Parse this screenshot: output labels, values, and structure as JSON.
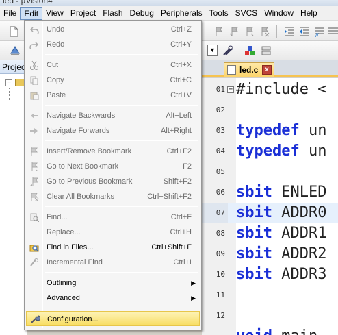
{
  "window": {
    "title": "led - µVision4"
  },
  "menubar": {
    "items": [
      {
        "name": "menu-file",
        "label": "File",
        "active": false
      },
      {
        "name": "menu-edit",
        "label": "Edit",
        "active": true
      },
      {
        "name": "menu-view",
        "label": "View",
        "active": false
      },
      {
        "name": "menu-project",
        "label": "Project",
        "active": false
      },
      {
        "name": "menu-flash",
        "label": "Flash",
        "active": false
      },
      {
        "name": "menu-debug",
        "label": "Debug",
        "active": false
      },
      {
        "name": "menu-peripherals",
        "label": "Peripherals",
        "active": false
      },
      {
        "name": "menu-tools",
        "label": "Tools",
        "active": false
      },
      {
        "name": "menu-svcs",
        "label": "SVCS",
        "active": false
      },
      {
        "name": "menu-window",
        "label": "Window",
        "active": false
      },
      {
        "name": "menu-help",
        "label": "Help",
        "active": false
      }
    ]
  },
  "project_panel": {
    "title": "Project"
  },
  "editor": {
    "tab_label": "led.c",
    "tab_close": "x",
    "lines": [
      {
        "num": "01",
        "code": "#include <",
        "fold": "−",
        "keyword": false
      },
      {
        "num": "02",
        "code": "",
        "keyword": false
      },
      {
        "num": "03",
        "code": "typedef un",
        "keyword": true,
        "kw": "typedef",
        "rest": " un"
      },
      {
        "num": "04",
        "code": "typedef un",
        "keyword": true,
        "kw": "typedef",
        "rest": " un"
      },
      {
        "num": "05",
        "code": "",
        "keyword": false
      },
      {
        "num": "06",
        "code": "sbit ENLED",
        "keyword": true,
        "kw": "sbit",
        "rest": " ENLED"
      },
      {
        "num": "07",
        "code": "sbit ADDR0",
        "keyword": true,
        "kw": "sbit",
        "rest": " ADDR0",
        "highlight": true
      },
      {
        "num": "08",
        "code": "sbit ADDR1",
        "keyword": true,
        "kw": "sbit",
        "rest": " ADDR1"
      },
      {
        "num": "09",
        "code": "sbit ADDR2",
        "keyword": true,
        "kw": "sbit",
        "rest": " ADDR2"
      },
      {
        "num": "10",
        "code": "sbit ADDR3",
        "keyword": true,
        "kw": "sbit",
        "rest": " ADDR3"
      },
      {
        "num": "11",
        "code": "",
        "keyword": false
      },
      {
        "num": "12",
        "code": "",
        "keyword": false
      },
      {
        "num": "",
        "code": "void main",
        "keyword": true,
        "kw": "void",
        "rest": " main"
      }
    ]
  },
  "edit_menu": {
    "items": [
      {
        "type": "item",
        "name": "menu-undo",
        "label": "Undo",
        "shortcut": "Ctrl+Z",
        "enabled": false,
        "icon": "undo-icon"
      },
      {
        "type": "item",
        "name": "menu-redo",
        "label": "Redo",
        "shortcut": "Ctrl+Y",
        "enabled": false,
        "icon": "redo-icon"
      },
      {
        "type": "sep"
      },
      {
        "type": "item",
        "name": "menu-cut",
        "label": "Cut",
        "shortcut": "Ctrl+X",
        "enabled": false,
        "icon": "scissors-icon"
      },
      {
        "type": "item",
        "name": "menu-copy",
        "label": "Copy",
        "shortcut": "Ctrl+C",
        "enabled": false,
        "icon": "copy-icon"
      },
      {
        "type": "item",
        "name": "menu-paste",
        "label": "Paste",
        "shortcut": "Ctrl+V",
        "enabled": false,
        "icon": "paste-icon"
      },
      {
        "type": "sep"
      },
      {
        "type": "item",
        "name": "menu-navigate-backwards",
        "label": "Navigate Backwards",
        "shortcut": "Alt+Left",
        "enabled": false,
        "icon": "arrow-left-icon"
      },
      {
        "type": "item",
        "name": "menu-navigate-forwards",
        "label": "Navigate Forwards",
        "shortcut": "Alt+Right",
        "enabled": false,
        "icon": "arrow-right-icon"
      },
      {
        "type": "sep"
      },
      {
        "type": "item",
        "name": "menu-insert-remove-bookmark",
        "label": "Insert/Remove Bookmark",
        "shortcut": "Ctrl+F2",
        "enabled": false,
        "icon": "bookmark-flag-icon"
      },
      {
        "type": "item",
        "name": "menu-go-to-next-bookmark",
        "label": "Go to Next Bookmark",
        "shortcut": "F2",
        "enabled": false,
        "icon": "next-bookmark-icon"
      },
      {
        "type": "item",
        "name": "menu-go-to-previous-bookmark",
        "label": "Go to Previous Bookmark",
        "shortcut": "Shift+F2",
        "enabled": false,
        "icon": "previous-bookmark-icon"
      },
      {
        "type": "item",
        "name": "menu-clear-all-bookmarks",
        "label": "Clear All Bookmarks",
        "shortcut": "Ctrl+Shift+F2",
        "enabled": false,
        "icon": "clear-bookmarks-icon"
      },
      {
        "type": "sep"
      },
      {
        "type": "item",
        "name": "menu-find",
        "label": "Find...",
        "shortcut": "Ctrl+F",
        "enabled": false,
        "icon": "find-icon"
      },
      {
        "type": "item",
        "name": "menu-replace",
        "label": "Replace...",
        "shortcut": "Ctrl+H",
        "enabled": false,
        "icon": ""
      },
      {
        "type": "item",
        "name": "menu-find-in-files",
        "label": "Find in Files...",
        "shortcut": "Ctrl+Shift+F",
        "enabled": true,
        "icon": "find-in-files-icon"
      },
      {
        "type": "item",
        "name": "menu-incremental-find",
        "label": "Incremental Find",
        "shortcut": "Ctrl+I",
        "enabled": false,
        "icon": "incremental-find-icon"
      },
      {
        "type": "sep"
      },
      {
        "type": "item",
        "name": "menu-outlining",
        "label": "Outlining",
        "shortcut": "",
        "enabled": true,
        "submenu": true,
        "icon": ""
      },
      {
        "type": "item",
        "name": "menu-advanced",
        "label": "Advanced",
        "shortcut": "",
        "enabled": true,
        "submenu": true,
        "icon": ""
      },
      {
        "type": "sep"
      },
      {
        "type": "item",
        "name": "menu-configuration",
        "label": "Configuration...",
        "shortcut": "",
        "enabled": true,
        "selected": true,
        "icon": "wrench-icon"
      }
    ]
  }
}
